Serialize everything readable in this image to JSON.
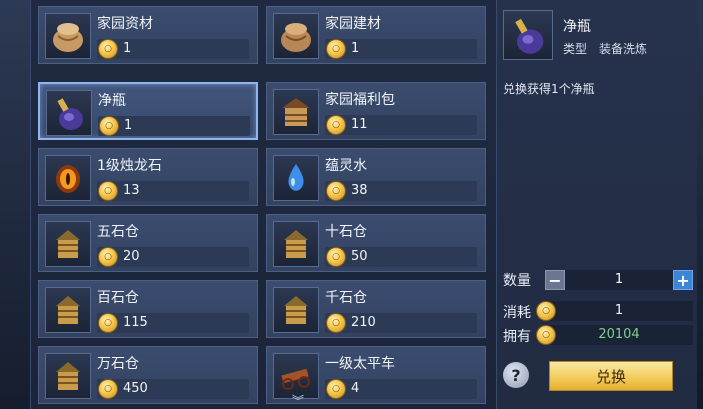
{
  "items": [
    {
      "name": "家园资材",
      "price": "1",
      "icon": "sack-icon"
    },
    {
      "name": "家园建材",
      "price": "1",
      "icon": "sack-icon"
    },
    {
      "name": "净瓶",
      "price": "1",
      "icon": "purple-vase-icon",
      "selected": true
    },
    {
      "name": "家园福利包",
      "price": "11",
      "icon": "gift-pavilion-icon"
    },
    {
      "name": "1级烛龙石",
      "price": "13",
      "icon": "fire-stone-icon"
    },
    {
      "name": "蕴灵水",
      "price": "38",
      "icon": "water-drop-icon"
    },
    {
      "name": "五石仓",
      "price": "20",
      "icon": "granary-icon"
    },
    {
      "name": "十石仓",
      "price": "50",
      "icon": "granary-icon"
    },
    {
      "name": "百石仓",
      "price": "115",
      "icon": "granary-icon"
    },
    {
      "name": "千石仓",
      "price": "210",
      "icon": "granary-icon"
    },
    {
      "name": "万石仓",
      "price": "450",
      "icon": "granary-icon"
    },
    {
      "name": "一级太平车",
      "price": "4",
      "icon": "cart-icon"
    }
  ],
  "detail": {
    "name": "净瓶",
    "type_label": "类型",
    "type_value": "装备洗炼",
    "description": "兑换获得1个净瓶"
  },
  "controls": {
    "quantity_label": "数量",
    "quantity": "1",
    "minus": "−",
    "plus": "+",
    "cost_label": "消耗",
    "cost": "1",
    "owned_label": "拥有",
    "owned": "20104",
    "help": "?",
    "exchange_label": "兑换"
  },
  "colors": {
    "owned_value": "#7fd08a",
    "exchange_button": "#f3c957",
    "selected_border": "#8fb4ee"
  }
}
